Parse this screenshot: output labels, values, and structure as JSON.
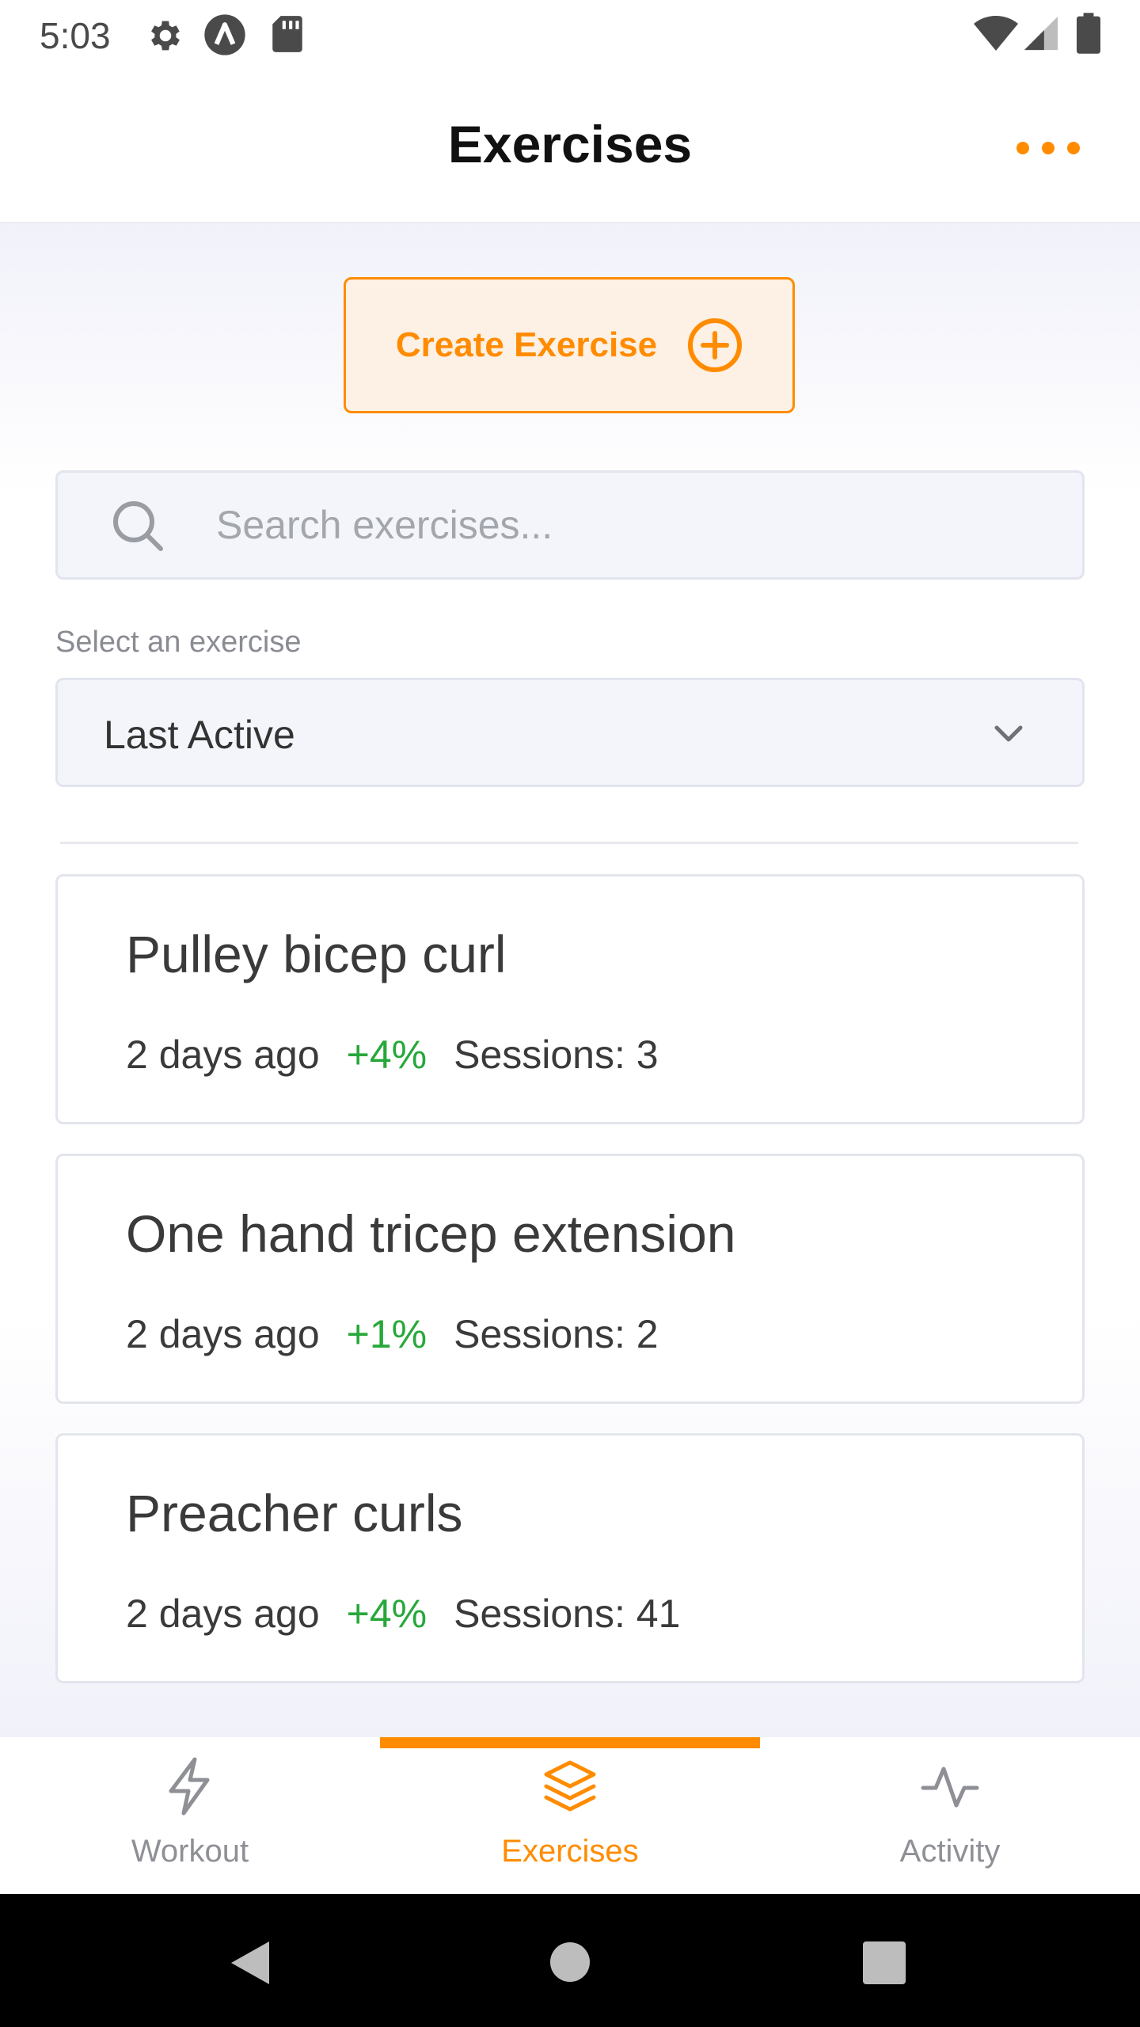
{
  "status_bar": {
    "time": "5:03",
    "left_icons": [
      "gear-icon",
      "a-circle-icon",
      "sd-card-icon"
    ],
    "right_icons": [
      "wifi-icon",
      "signal-icon",
      "battery-icon"
    ]
  },
  "header": {
    "title": "Exercises",
    "menu_icon": "more-horizontal-icon"
  },
  "create_button": {
    "label": "Create Exercise",
    "icon": "plus-circle-icon"
  },
  "search": {
    "placeholder": "Search exercises...",
    "value": ""
  },
  "filter": {
    "label": "Select an exercise",
    "selected": "Last Active"
  },
  "exercises": [
    {
      "name": "Pulley bicep curl",
      "last": "2 days ago",
      "change": "+4%",
      "sessions": "Sessions: 3"
    },
    {
      "name": "One hand tricep extension",
      "last": "2 days ago",
      "change": "+1%",
      "sessions": "Sessions: 2"
    },
    {
      "name": "Preacher curls",
      "last": "2 days ago",
      "change": "+4%",
      "sessions": "Sessions: 41"
    }
  ],
  "bottom_nav": {
    "items": [
      {
        "label": "Workout",
        "icon": "lightning-icon"
      },
      {
        "label": "Exercises",
        "icon": "layers-icon",
        "active": true
      },
      {
        "label": "Activity",
        "icon": "activity-icon"
      }
    ]
  },
  "colors": {
    "accent": "#ff8c00",
    "positive": "#27a83a",
    "muted": "#8e9096"
  }
}
